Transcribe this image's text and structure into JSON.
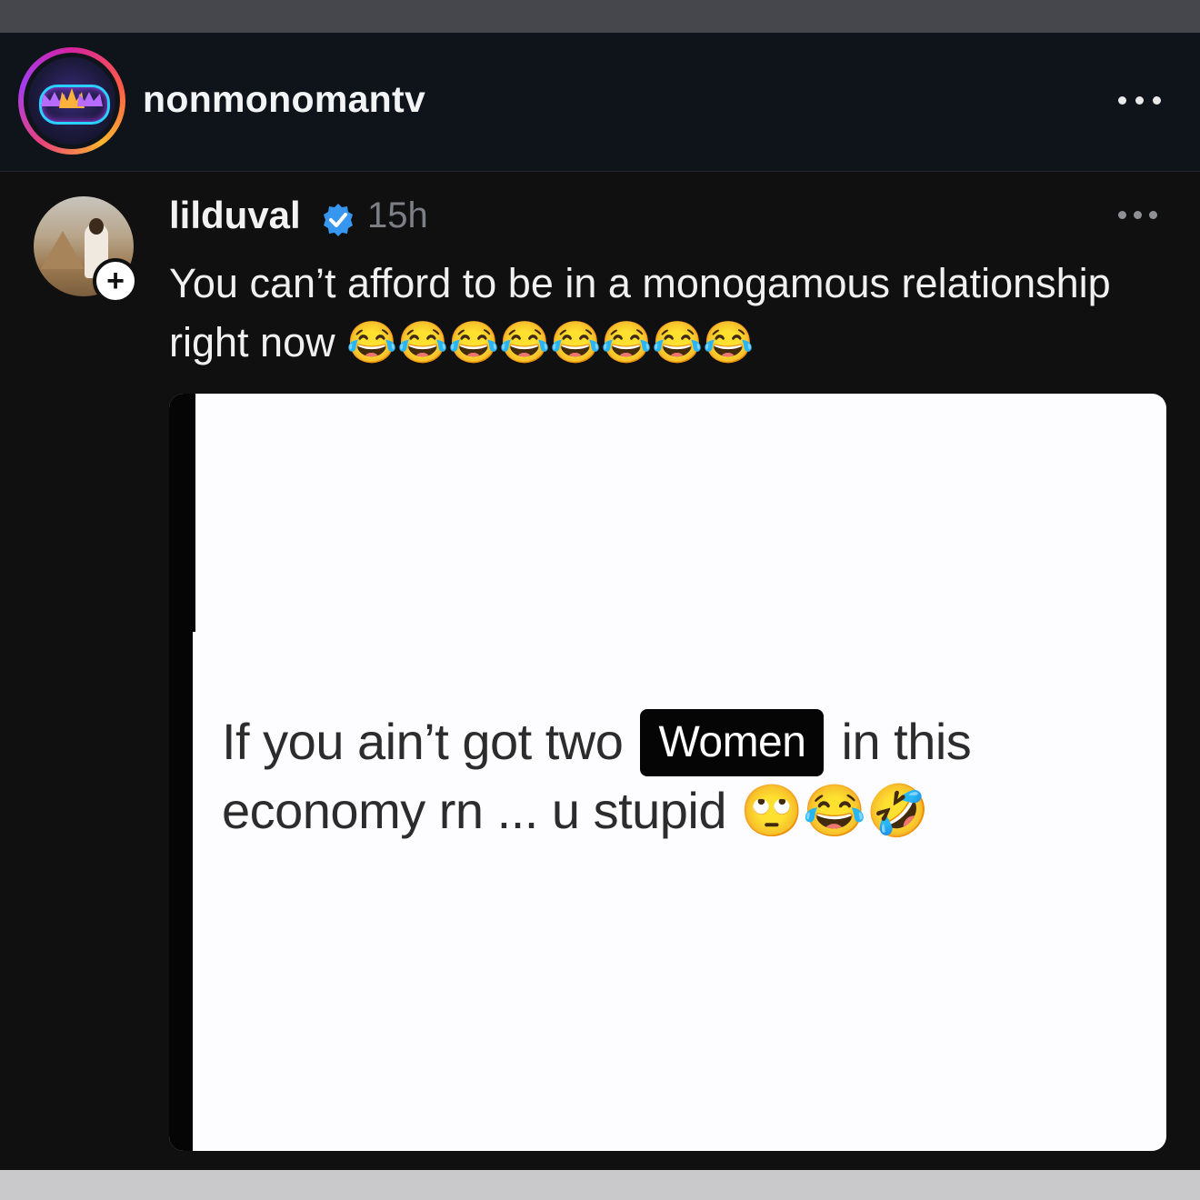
{
  "header": {
    "account_name": "nonmonomantv",
    "more_icon": "more-horizontal-icon"
  },
  "post": {
    "username": "lilduval",
    "verified_icon": "verified-badge-icon",
    "timestamp": "15h",
    "follow_icon": "plus-icon",
    "follow_label": "+",
    "caption": "You can’t afford to be in a monogamous relationship right now 😂😂😂😂😂😂😂😂",
    "more_icon": "more-horizontal-icon"
  },
  "media": {
    "text_before": "If you ain’t got two",
    "highlight": "Women",
    "text_after": " in this economy rn ... u stupid 🙄😂🤣"
  },
  "colors": {
    "header_bg": "#0f141a",
    "post_bg": "#101010",
    "verified": "#3797f0",
    "timestamp": "#7c7f86"
  }
}
